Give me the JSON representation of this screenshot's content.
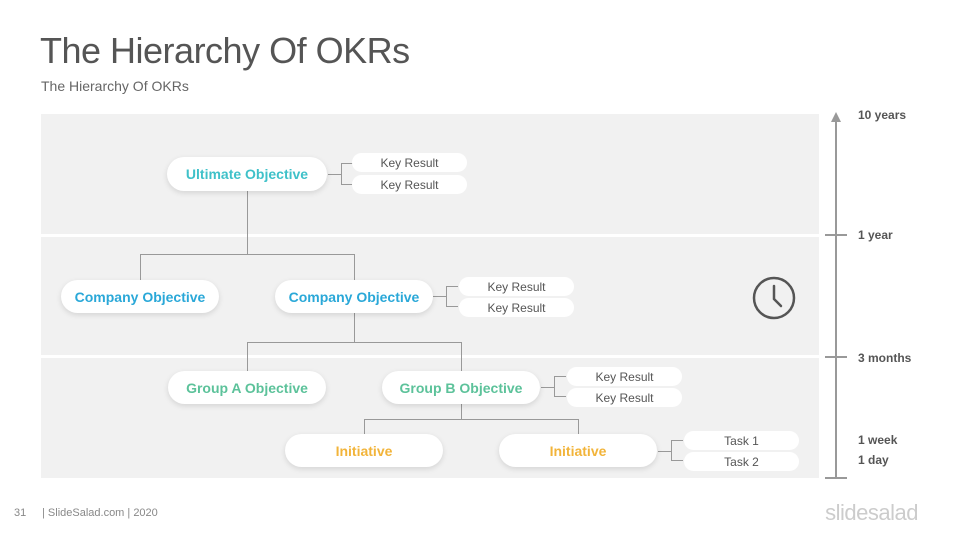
{
  "header": {
    "title": "The Hierarchy Of OKRs",
    "subtitle": "The Hierarchy Of OKRs"
  },
  "diagram": {
    "ultimate": {
      "label": "Ultimate Objective",
      "key_results": [
        "Key Result",
        "Key Result"
      ]
    },
    "company": [
      {
        "label": "Company Objective"
      },
      {
        "label": "Company Objective",
        "key_results": [
          "Key Result",
          "Key Result"
        ]
      }
    ],
    "groups": [
      {
        "label": "Group A Objective"
      },
      {
        "label": "Group B Objective",
        "key_results": [
          "Key Result",
          "Key Result"
        ]
      }
    ],
    "initiatives": [
      {
        "label": "Initiative"
      },
      {
        "label": "Initiative",
        "tasks": [
          "Task 1",
          "Task 2"
        ]
      }
    ],
    "colors": {
      "ultimate": "#3fc1c9",
      "company": "#2aa8d8",
      "group": "#5cc29a",
      "initiative": "#f2b43a"
    }
  },
  "timeline": {
    "labels": [
      "10 years",
      "1 year",
      "3 months",
      "1 week",
      "1 day"
    ],
    "icon": "clock-icon"
  },
  "footer": {
    "page_number": "31",
    "credit": "| SlideSalad.com | 2020",
    "brand": "slidesalad"
  }
}
